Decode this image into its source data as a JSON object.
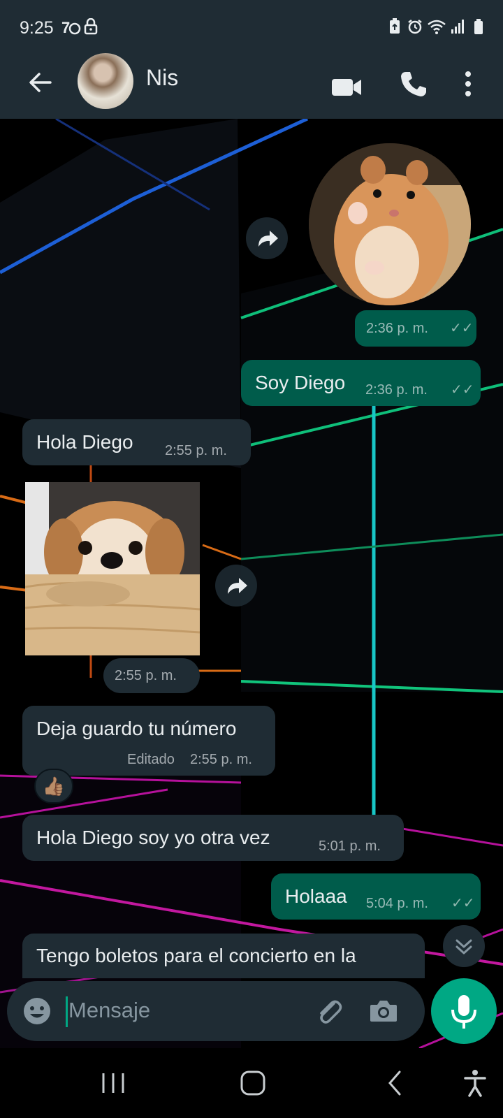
{
  "status_bar": {
    "time": "9:25"
  },
  "header": {
    "contact_name": "Nis"
  },
  "messages": {
    "m1_time": "2:36 p. m.",
    "m2_text": "Soy Diego",
    "m2_time": "2:36 p. m.",
    "m3_text": "Hola Diego",
    "m3_time": "2:55 p. m.",
    "m4_time": "2:55 p. m.",
    "m5_text": "Deja guardo tu número",
    "m5_edited": "Editado",
    "m5_time": "2:55 p. m.",
    "m5_reaction": "👍🏽",
    "m6_text": "Hola Diego soy yo otra vez",
    "m6_time": "5:01 p. m.",
    "m7_text": "Holaaa",
    "m7_time": "5:04 p. m.",
    "m8_text": "Tengo boletos para el concierto en la"
  },
  "input": {
    "placeholder": "Mensaje"
  },
  "colors": {
    "header_bg": "#1f2c34",
    "incoming_bubble": "#1f2c34",
    "outgoing_bubble": "#005c4b",
    "accent": "#00a884"
  },
  "icons": {
    "back": "arrow-left-icon",
    "video": "video-call-icon",
    "voice": "phone-icon",
    "menu": "more-vert-icon",
    "forward": "forward-arrow-icon",
    "emoji": "emoji-icon",
    "attach": "paperclip-icon",
    "camera": "camera-icon",
    "mic": "microphone-icon"
  }
}
